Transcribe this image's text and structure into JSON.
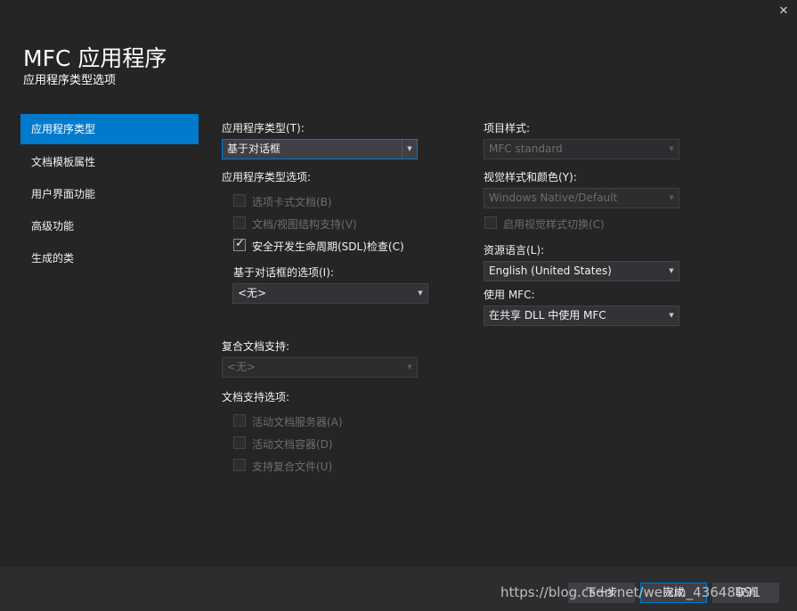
{
  "window": {
    "title": "MFC 应用程序",
    "subtitle": "应用程序类型选项",
    "close_glyph": "✕"
  },
  "nav": {
    "items": [
      {
        "label": "应用程序类型",
        "selected": true
      },
      {
        "label": "文档模板属性"
      },
      {
        "label": "用户界面功能"
      },
      {
        "label": "高级功能"
      },
      {
        "label": "生成的类"
      }
    ]
  },
  "left": {
    "app_type_label": "应用程序类型(T):",
    "app_type_value": "基于对话框",
    "app_type_options_label": "应用程序类型选项:",
    "options": [
      {
        "label": "选项卡式文档(B)",
        "checked": false,
        "enabled": false
      },
      {
        "label": "文档/视图结构支持(V)",
        "checked": false,
        "enabled": false
      },
      {
        "label": "安全开发生命周期(SDL)检查(C)",
        "checked": true,
        "enabled": true
      }
    ],
    "dialog_options_label": "基于对话框的选项(I):",
    "dialog_options_value": "<无>",
    "compound_doc_label": "复合文档支持:",
    "compound_doc_value": "<无>",
    "doc_support_label": "文档支持选项:",
    "doc_support_options": [
      {
        "label": "活动文档服务器(A)",
        "checked": false,
        "enabled": false
      },
      {
        "label": "活动文档容器(D)",
        "checked": false,
        "enabled": false
      },
      {
        "label": "支持复合文件(U)",
        "checked": false,
        "enabled": false
      }
    ]
  },
  "right": {
    "project_style_label": "项目样式:",
    "project_style_value": "MFC standard",
    "visual_style_label": "视觉样式和颜色(Y):",
    "visual_style_value": "Windows Native/Default",
    "visual_style_switch_label": "启用视觉样式切换(C)",
    "resource_lang_label": "资源语言(L):",
    "resource_lang_value": "English (United States)",
    "use_mfc_label": "使用 MFC:",
    "use_mfc_value": "在共享 DLL 中使用 MFC"
  },
  "footer": {
    "next_label": "下一步",
    "finish_label": "完成",
    "cancel_label": "取消",
    "watermark": "https://blog.csdn.net/weixin_43648991"
  },
  "colors": {
    "background": "#252526",
    "accent": "#007acc",
    "footer": "#2d2d30"
  }
}
